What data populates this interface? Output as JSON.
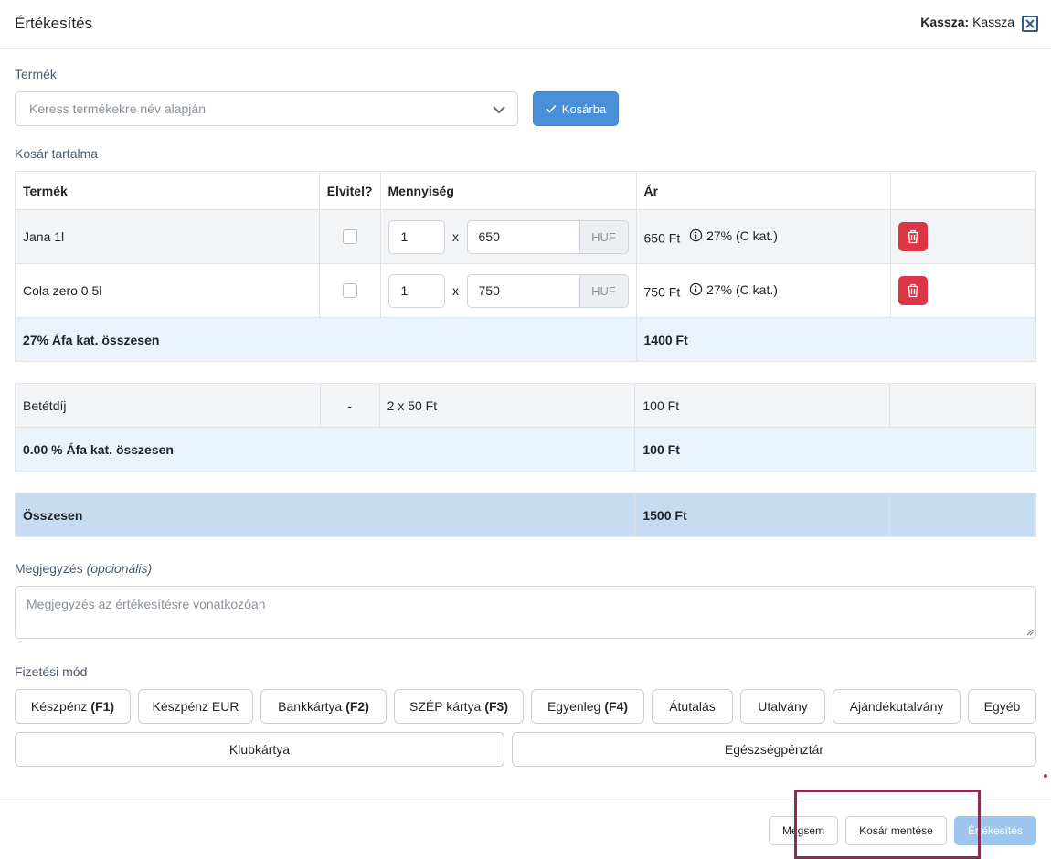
{
  "header": {
    "title": "Értékesítés",
    "kassza_label": "Kassza:",
    "kassza_value": "Kassza"
  },
  "product": {
    "label": "Termék",
    "search_placeholder": "Keress termékekre név alapján",
    "add_button": "Kosárba"
  },
  "cart": {
    "label": "Kosár tartalma",
    "columns": [
      "Termék",
      "Elvitel?",
      "Mennyiség",
      "Ár",
      ""
    ],
    "items": [
      {
        "name": "Jana 1l",
        "qty": "1",
        "x": "x",
        "unit_price": "650",
        "currency": "HUF",
        "price": "650 Ft",
        "vat": "27% (C kat.)"
      },
      {
        "name": "Cola zero 0,5l",
        "qty": "1",
        "x": "x",
        "unit_price": "750",
        "currency": "HUF",
        "price": "750 Ft",
        "vat": "27% (C kat.)"
      }
    ],
    "vat27_total_label": "27% Áfa kat. összesen",
    "vat27_total_value": "1400 Ft",
    "deposit": {
      "name": "Betétdíj",
      "takeaway": "-",
      "qty": "2 x 50 Ft",
      "price": "100 Ft"
    },
    "vat0_total_label": "0.00 % Áfa kat. összesen",
    "vat0_total_value": "100 Ft",
    "grand_total_label": "Összesen",
    "grand_total_value": "1500 Ft"
  },
  "note": {
    "label": "Megjegyzés",
    "optional": "(opcionális)",
    "placeholder": "Megjegyzés az értékesítésre vonatkozóan"
  },
  "payment": {
    "label": "Fizetési mód",
    "methods": [
      {
        "label": "Készpénz",
        "key": "(F1)"
      },
      {
        "label": "Készpénz EUR",
        "key": ""
      },
      {
        "label": "Bankkártya",
        "key": "(F2)"
      },
      {
        "label": "SZÉP kártya",
        "key": "(F3)"
      },
      {
        "label": "Egyenleg",
        "key": "(F4)"
      },
      {
        "label": "Átutalás",
        "key": ""
      },
      {
        "label": "Utalvány",
        "key": ""
      },
      {
        "label": "Ajándékutalvány",
        "key": ""
      },
      {
        "label": "Egyéb",
        "key": ""
      },
      {
        "label": "Klubkártya",
        "key": ""
      },
      {
        "label": "Egészségpénztár",
        "key": ""
      }
    ]
  },
  "footer": {
    "cancel": "Mégsem",
    "save_cart": "Kosár mentése",
    "submit": "Értékesítés"
  },
  "colors": {
    "primary": "#4a90d9",
    "danger": "#dc3545",
    "total_row": "#c7dcf0",
    "subtotal_row": "#eaf3fc",
    "highlight": "#8b2c54"
  }
}
